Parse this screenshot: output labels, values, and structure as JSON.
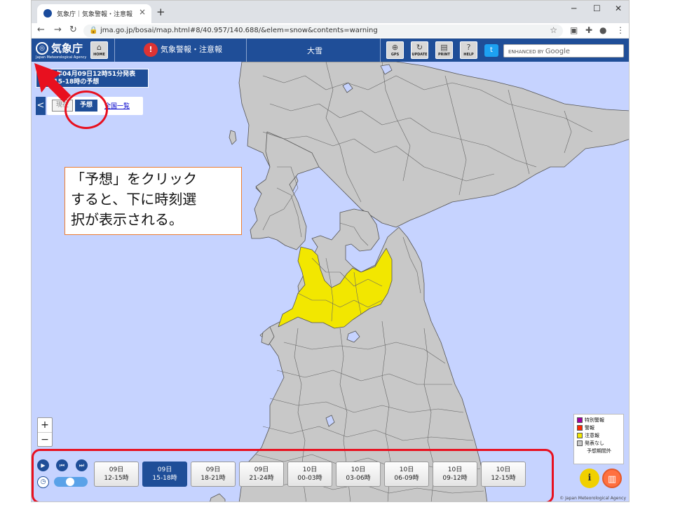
{
  "browser": {
    "tab_title": "気象庁｜気象警報・注意報",
    "tab_close": "×",
    "new_tab": "+",
    "win_min": "─",
    "win_max": "☐",
    "win_close": "✕",
    "back": "←",
    "forward": "→",
    "reload": "↻",
    "lock": "🔒",
    "url": "jma.go.jp/bosai/map.html#8/40.957/140.688/&elem=snow&contents=warning",
    "star": "☆",
    "ext1": "▣",
    "ext2": "✚",
    "profile": "●",
    "menu": "⋮"
  },
  "header": {
    "logo_ja": "気象庁",
    "logo_en": "Japan Meteorological Agency",
    "home": "HOME",
    "warn_label": "気象警報・注意報",
    "elem_label": "大雪",
    "gps": "GPS",
    "update": "UPDATE",
    "print": "PRINT",
    "help": "HELP",
    "search_prefix": "ENHANCED BY",
    "search_brand": "Google"
  },
  "info": {
    "issued": "2021年04月09日12時51分発表",
    "period": "09日15-18時の予想"
  },
  "panel": {
    "back_arrow": "<",
    "tab_now": "現在",
    "tab_forecast": "予想",
    "tab_all": "全国一覧"
  },
  "callout": {
    "text1": "「予想」をクリック",
    "text2": "すると、下に時刻選",
    "text3": "択が表示される。"
  },
  "zoom": {
    "in": "+",
    "out": "−"
  },
  "legend": {
    "items": [
      {
        "label": "特別警報",
        "color": "#a000a0"
      },
      {
        "label": "警報",
        "color": "#ff2800"
      },
      {
        "label": "注意報",
        "color": "#f2e700"
      },
      {
        "label": "発表なし",
        "color": "#c8c8c8"
      }
    ],
    "extra": "予想期間外"
  },
  "controls": {
    "play": "▶",
    "prev": "⏮",
    "next": "⏭",
    "clock": "◷"
  },
  "timeline": [
    {
      "day": "09日",
      "time": "12-15時",
      "selected": false
    },
    {
      "day": "09日",
      "time": "15-18時",
      "selected": true
    },
    {
      "day": "09日",
      "time": "18-21時",
      "selected": false
    },
    {
      "day": "09日",
      "time": "21-24時",
      "selected": false
    },
    {
      "day": "10日",
      "time": "00-03時",
      "selected": false
    },
    {
      "day": "10日",
      "time": "03-06時",
      "selected": false
    },
    {
      "day": "10日",
      "time": "06-09時",
      "selected": false
    },
    {
      "day": "10日",
      "time": "09-12時",
      "selected": false
    },
    {
      "day": "10日",
      "time": "12-15時",
      "selected": false
    }
  ],
  "copyright": "© Japan Meteorological Agency",
  "colors": {
    "brand": "#1f4e98",
    "sea": "#c6d3ff",
    "land": "#c8c8c8",
    "advisory": "#f2e700",
    "highlight": "#e8101f"
  }
}
